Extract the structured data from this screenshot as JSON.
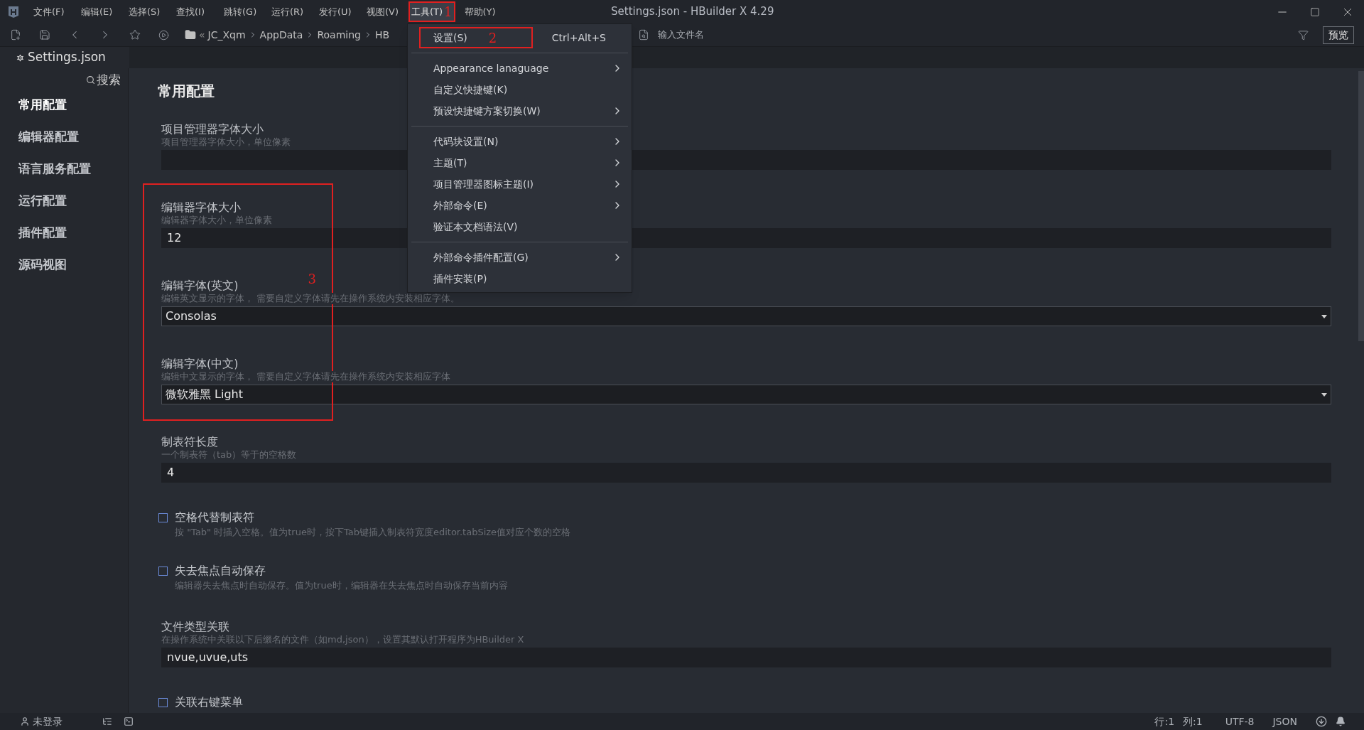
{
  "window": {
    "title": "Settings.json - HBuilder X 4.29"
  },
  "menubar": [
    {
      "label": "文件(F)",
      "selected": false
    },
    {
      "label": "编辑(E)",
      "selected": false
    },
    {
      "label": "选择(S)",
      "selected": false
    },
    {
      "label": "查找(I)",
      "selected": false
    },
    {
      "label": "跳转(G)",
      "selected": false
    },
    {
      "label": "运行(R)",
      "selected": false
    },
    {
      "label": "发行(U)",
      "selected": false
    },
    {
      "label": "视图(V)",
      "selected": false
    },
    {
      "label": "工具(T)",
      "selected": true,
      "annotation": "1"
    },
    {
      "label": "帮助(Y)",
      "selected": false
    }
  ],
  "toolbar": {
    "breadcrumb_prefix": "«",
    "breadcrumb": [
      "JC_Xqm",
      "AppData",
      "Roaming",
      "HB"
    ],
    "search": {
      "placeholder": "输入文件名"
    },
    "preview_button": "预览"
  },
  "tab": {
    "label": "Settings.json"
  },
  "sidebar": {
    "search": "搜索",
    "items": [
      {
        "label": "常用配置",
        "selected": true
      },
      {
        "label": "编辑器配置",
        "selected": false
      },
      {
        "label": "语言服务配置",
        "selected": false
      },
      {
        "label": "运行配置",
        "selected": false
      },
      {
        "label": "插件配置",
        "selected": false
      },
      {
        "label": "源码视图",
        "selected": false
      }
    ]
  },
  "section_title": "常用配置",
  "settings": [
    {
      "kind": "text",
      "label": "项目管理器字体大小",
      "description": "项目管理器字体大小，单位像素"
    },
    {
      "kind": "text",
      "label": "编辑器字体大小",
      "description": "编辑器字体大小，单位像素",
      "value": "12"
    },
    {
      "kind": "select",
      "label": "编辑字体(英文)",
      "description": "编辑英文显示的字体， 需要自定义字体请先在操作系统内安装相应字体。",
      "value": "Consolas"
    },
    {
      "kind": "select",
      "label": "编辑字体(中文)",
      "description": "编辑中文显示的字体， 需要自定义字体请先在操作系统内安装相应字体",
      "value": "微软雅黑 Light"
    },
    {
      "kind": "text",
      "label": "制表符长度",
      "description": "一个制表符（tab）等于的空格数",
      "value": "4"
    },
    {
      "kind": "checkbox",
      "label": "空格代替制表符",
      "description": "按 \"Tab\" 时插入空格。值为true时，按下Tab键插入制表符宽度editor.tabSize值对应个数的空格",
      "checked": false
    },
    {
      "kind": "checkbox",
      "label": "失去焦点自动保存",
      "description": "编辑器失去焦点时自动保存。值为true时，编辑器在失去焦点时自动保存当前内容",
      "checked": false
    },
    {
      "kind": "text",
      "label": "文件类型关联",
      "description": "在操作系统中关联以下后缀名的文件（如md,json），设置其默认打开程序为HBuilder X",
      "value": "nvue,uvue,uts"
    },
    {
      "kind": "checkbox",
      "label": "关联右键菜单",
      "checked": false
    }
  ],
  "menu": [
    {
      "kind": "item",
      "label": "设置(S)",
      "shortcut": "Ctrl+Alt+S",
      "submenu": false,
      "annotation": "2"
    },
    {
      "kind": "separator"
    },
    {
      "kind": "item",
      "label": "Appearance lanaguage",
      "submenu": true
    },
    {
      "kind": "item",
      "label": "自定义快捷键(K)",
      "submenu": false
    },
    {
      "kind": "item",
      "label": "预设快捷键方案切换(W)",
      "submenu": true
    },
    {
      "kind": "separator"
    },
    {
      "kind": "item",
      "label": "代码块设置(N)",
      "submenu": true
    },
    {
      "kind": "item",
      "label": "主题(T)",
      "submenu": true
    },
    {
      "kind": "item",
      "label": "项目管理器图标主题(I)",
      "submenu": true
    },
    {
      "kind": "item",
      "label": "外部命令(E)",
      "submenu": true
    },
    {
      "kind": "item",
      "label": "验证本文档语法(V)",
      "submenu": false
    },
    {
      "kind": "separator"
    },
    {
      "kind": "item",
      "label": "外部命令插件配置(G)",
      "submenu": true
    },
    {
      "kind": "item",
      "label": "插件安装(P)",
      "submenu": false
    }
  ],
  "settings_annotation": {
    "label": "3"
  },
  "status_bar": {
    "user": "未登录",
    "position": [
      "行:1",
      "列:1"
    ],
    "encoding": "UTF-8",
    "language": "JSON"
  }
}
